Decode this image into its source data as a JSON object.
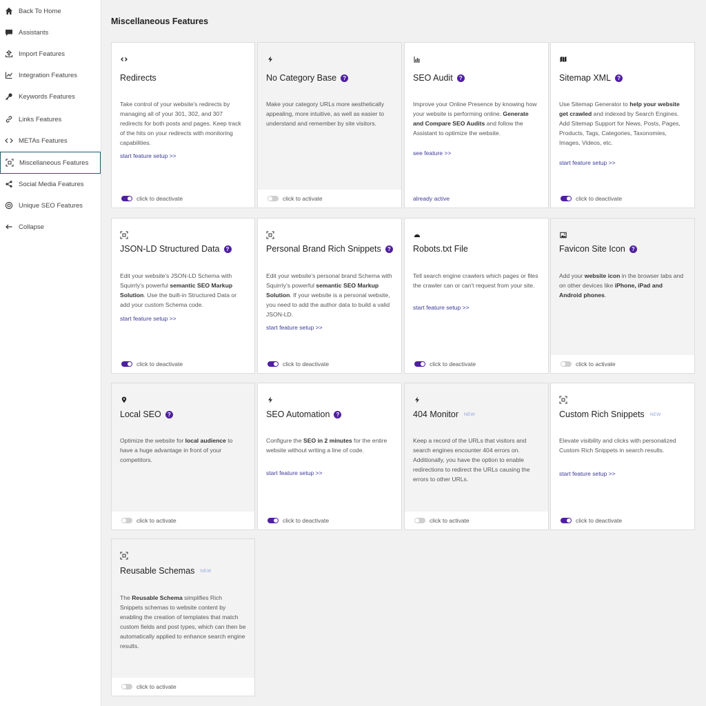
{
  "sidebar": {
    "items": [
      {
        "label": "Back To Home",
        "icon": "home-icon"
      },
      {
        "label": "Assistants",
        "icon": "chat-icon"
      },
      {
        "label": "Import Features",
        "icon": "upload-icon"
      },
      {
        "label": "Integration Features",
        "icon": "chart-line-icon"
      },
      {
        "label": "Keywords Features",
        "icon": "key-icon"
      },
      {
        "label": "Links Features",
        "icon": "link-icon"
      },
      {
        "label": "METAs Features",
        "icon": "code-icon"
      },
      {
        "label": "Miscellaneous Features",
        "icon": "scan-icon",
        "active": true
      },
      {
        "label": "Social Media Features",
        "icon": "share-icon"
      },
      {
        "label": "Unique SEO Features",
        "icon": "at-icon"
      },
      {
        "label": "Collapse",
        "icon": "arrow-left-icon"
      }
    ]
  },
  "main": {
    "title": "Miscellaneous Features",
    "cards": [
      {
        "title": "Redirects",
        "help": false,
        "new": false,
        "icon": "redirect-icon",
        "desc_html": "Take control of your website's redirects by managing all of your 301, 302, and 307 redirects for both posts and pages. Keep track of the hits on your redirects with monitoring capabilities.",
        "link": "start feature setup >>",
        "status": "click to deactivate",
        "active": true
      },
      {
        "title": "No Category Base",
        "help": true,
        "new": false,
        "icon": "bolt-icon",
        "desc_html": "Make your category URLs more aesthetically appealing, more intuitive, as well as easier to understand and remember by site visitors.",
        "link": "",
        "status": "click to activate",
        "active": false
      },
      {
        "title": "SEO Audit",
        "help": true,
        "new": false,
        "icon": "bar-chart-icon",
        "desc_html": "Improve your Online Presence by knowing how your website is performing online. <b>Generate and Compare SEO Audits</b> and follow the Assistant to optimize the website.",
        "link": "see feature >>",
        "status": "already active",
        "active": true
      },
      {
        "title": "Sitemap XML",
        "help": true,
        "new": false,
        "icon": "map-icon",
        "desc_html": "Use Sitemap Generator to <b>help your website get crawled</b> and indexed by Search Engines. Add Sitemap Support for News, Posts, Pages, Products, Tags, Categories, Taxonomies, Images, Videos, etc.",
        "link": "start feature setup >>",
        "status": "click to deactivate",
        "active": true
      },
      {
        "title": "JSON-LD Structured Data",
        "help": true,
        "new": false,
        "icon": "scan-icon",
        "desc_html": "Edit your website's JSON-LD Schema with Squirrly's powerful <b>semantic SEO Markup Solution</b>. Use the built-in Structured Data or add your custom Schema code.",
        "link": "start feature setup >>",
        "status": "click to deactivate",
        "active": true
      },
      {
        "title": "Personal Brand Rich Snippets",
        "help": true,
        "new": false,
        "icon": "scan-icon",
        "desc_html": "Edit your website's personal brand Schema with Squirrly's powerful <b>semantic SEO Markup Solution</b>. If your website is a personal website, you need to add the author data to build a valid JSON-LD.",
        "link": "start feature setup >>",
        "status": "click to deactivate",
        "active": true
      },
      {
        "title": "Robots.txt File",
        "help": false,
        "new": false,
        "icon": "robot-icon",
        "desc_html": "Tell search engine crawlers which pages or files the crawler can or can't request from your site.",
        "link": "start feature setup >>",
        "status": "click to deactivate",
        "active": true
      },
      {
        "title": "Favicon Site Icon",
        "help": true,
        "new": false,
        "icon": "image-icon",
        "desc_html": "Add your <b>website icon</b> in the browser tabs and on other devices like <b>iPhone, iPad and Android phones</b>.",
        "link": "",
        "status": "click to activate",
        "active": false
      },
      {
        "title": "Local SEO",
        "help": true,
        "new": false,
        "icon": "pin-icon",
        "desc_html": "Optimize the website for <b>local audience</b> to have a huge advantage in front of your competitors.",
        "link": "",
        "status": "click to activate",
        "active": false
      },
      {
        "title": "SEO Automation",
        "help": true,
        "new": false,
        "icon": "bolt-icon",
        "desc_html": "Configure the <b>SEO in 2 minutes</b> for the entire website without writing a line of code.",
        "link": "start feature setup >>",
        "status": "click to deactivate",
        "active": true
      },
      {
        "title": "404 Monitor",
        "help": false,
        "new": true,
        "icon": "bolt-icon",
        "desc_html": "Keep a record of the URLs that visitors and search engines encounter 404 errors on. Additionally, you have the option to enable redirections to redirect the URLs causing the errors to other URLs.",
        "link": "",
        "status": "click to activate",
        "active": false
      },
      {
        "title": "Custom Rich Snippets",
        "help": false,
        "new": true,
        "icon": "scan-icon",
        "desc_html": "Elevate visibility and clicks with personalized Custom Rich Snippets in search results.",
        "link": "start feature setup >>",
        "status": "click to deactivate",
        "active": true
      },
      {
        "title": "Reusable Schemas",
        "help": false,
        "new": true,
        "icon": "scan-icon",
        "desc_html": "The <b>Reusable Schema</b> simplifies Rich Snippets schemas to website content by enabling the creation of templates that match custom fields and post types, which can then be automatically applied to enhance search engine results.",
        "link": "",
        "status": "click to activate",
        "active": false
      }
    ],
    "new_label": "NEW",
    "help_label": "?"
  }
}
